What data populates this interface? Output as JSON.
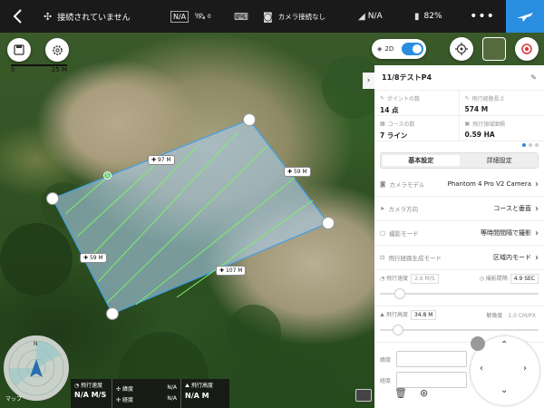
{
  "topbar": {
    "status": "接続されていません",
    "mode": "N/A",
    "satellite": "0",
    "camera_status": "カメラ接続なし",
    "signal": "N/A",
    "battery": "82%"
  },
  "map": {
    "scale_start": "0",
    "scale_end": "25 M",
    "toggle_label": "2D",
    "tags": [
      "97 M",
      "59 M",
      "59 M",
      "107 M"
    ],
    "map_watermark": "マップ"
  },
  "mission": {
    "name": "11/8テストP4",
    "stats": [
      {
        "label": "ポイントの数",
        "value": "14 点"
      },
      {
        "label": "飛行経路長さ",
        "value": "574 M"
      },
      {
        "label": "コースの数",
        "value": "7 ライン"
      },
      {
        "label": "飛行領域面積",
        "value": "0.59 HA"
      }
    ],
    "tabs": [
      "基本設定",
      "詳細設定"
    ],
    "settings": [
      {
        "label": "カメラモデル",
        "value": "Phantom 4 Pro V2 Camera"
      },
      {
        "label": "カメラ方向",
        "value": "コースと垂直"
      },
      {
        "label": "撮影モード",
        "value": "等時間間隔で撮影"
      },
      {
        "label": "飛行経路生成モード",
        "value": "区域内モード"
      }
    ],
    "speed": {
      "label": "飛行速度",
      "value": "2.6 M/S",
      "interval_label": "撮影間隔",
      "interval": "4.9 SEC"
    },
    "altitude": {
      "label": "飛行高度",
      "value": "34.8 M",
      "res_label": "解像度",
      "res": "1.0 CM/PX"
    },
    "lat_label": "緯度",
    "lon_label": "経度"
  },
  "telemetry": {
    "speed_label": "飛行速度",
    "speed_value": "N/A M/S",
    "lat_label": "緯度",
    "lat_value": "N/A",
    "lon_label": "経度",
    "lon_value": "N/A",
    "alt_label": "飛行高度",
    "alt_value": "N/A M"
  }
}
